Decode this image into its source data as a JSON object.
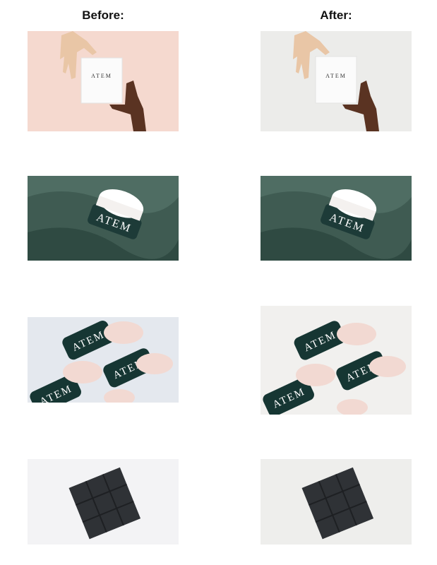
{
  "columns": {
    "before_label": "Before:",
    "after_label": "After:"
  },
  "brand_mark": "ATEM",
  "rows": [
    {
      "subject": "booklet-with-hands",
      "before_bg": "#f5d9cf",
      "after_bg": "#ececea"
    },
    {
      "subject": "jar-on-velvet",
      "before_bg": "#3f5b52",
      "after_bg": "#3f5b52"
    },
    {
      "subject": "group-of-jars",
      "before_bg": "#e4e8ee",
      "after_bg": "#f1f0ee"
    },
    {
      "subject": "stacked-boxes",
      "before_bg": "#f3f3f5",
      "after_bg": "#eeeeec"
    }
  ]
}
